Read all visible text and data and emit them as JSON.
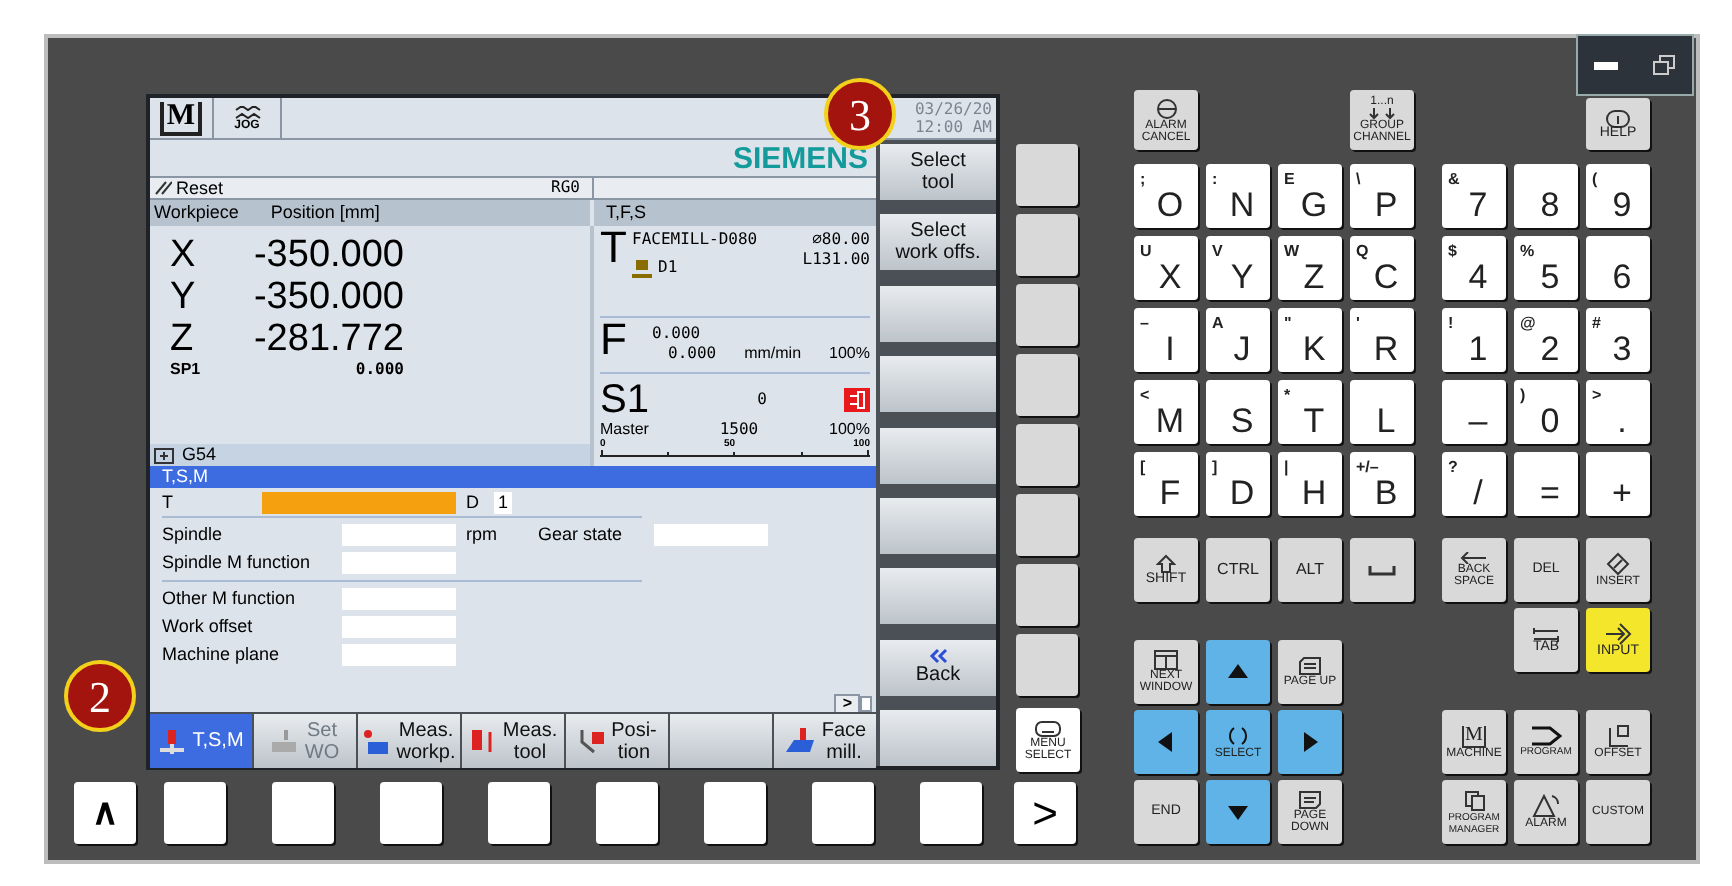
{
  "screen": {
    "header": {
      "mode_icon_text": "M",
      "jog_label": "JOG",
      "date": "03/26/20",
      "time": "12:00 AM"
    },
    "brand": "SIEMENS",
    "status": {
      "state": "Reset",
      "channel": "RG0"
    },
    "position_panel": {
      "headers": [
        "Workpiece",
        "Position [mm]"
      ],
      "axes": [
        {
          "kind": "axis",
          "name": "X",
          "value": "-350.000"
        },
        {
          "kind": "axis",
          "name": "Y",
          "value": "-350.000"
        },
        {
          "kind": "axis",
          "name": "Z",
          "value": "-281.772"
        },
        {
          "kind": "spindle",
          "name": "SP1",
          "value": "0.000"
        }
      ],
      "work_offset": "G54"
    },
    "tfs_panel": {
      "title": "T,F,S",
      "tool": {
        "letter": "T",
        "name": "FACEMILL-D080",
        "diameter": "⌀80.00",
        "edge": "D1",
        "length": "L131.00"
      },
      "feed": {
        "letter": "F",
        "setpoint": "0.000",
        "actual": "0.000",
        "unit": "mm/min",
        "override": "100%"
      },
      "spindle": {
        "letter": "S1",
        "speed": "0",
        "master": "Master",
        "setpoint": "1500",
        "override": "100%",
        "scale": [
          "0",
          "50",
          "100"
        ]
      }
    },
    "tsm_panel": {
      "title": "T,S,M",
      "tool_row": {
        "label": "T",
        "focused": true,
        "edge_label": "D",
        "edge_value": "1"
      },
      "groups": [
        [
          {
            "label": "Spindle",
            "focused": false,
            "unit": "rpm",
            "side_field": {
              "label": "Gear state",
              "focused": false
            }
          },
          {
            "label": "Spindle M function",
            "focused": false
          }
        ],
        [
          {
            "label": "Other M function",
            "focused": false
          },
          {
            "label": "Work offset",
            "focused": false
          },
          {
            "label": "Machine plane",
            "focused": false
          }
        ]
      ],
      "scroll_arrow": ">"
    },
    "horizontal_softkeys": [
      {
        "kind": "tool",
        "lines": [
          "T,S,M"
        ],
        "selected": true,
        "disabled": false
      },
      {
        "kind": "offset",
        "lines": [
          "Set",
          "WO"
        ],
        "selected": false,
        "disabled": true
      },
      {
        "kind": "workpiece",
        "lines": [
          "Meas.",
          "workp."
        ],
        "selected": false,
        "disabled": false
      },
      {
        "kind": "probe",
        "lines": [
          "Meas.",
          "tool"
        ],
        "selected": false,
        "disabled": false
      },
      {
        "kind": "position",
        "lines": [
          "Posi-",
          "tion"
        ],
        "selected": false,
        "disabled": false
      },
      {
        "kind": "blank"
      },
      {
        "kind": "facemill",
        "lines": [
          "Face",
          "mill."
        ],
        "selected": false,
        "disabled": false
      }
    ],
    "vertical_softkeys": [
      {
        "kind": "text",
        "lines": [
          "Select",
          "tool"
        ]
      },
      {
        "kind": "text",
        "lines": [
          "Select",
          "work offs."
        ]
      },
      {
        "kind": "blank"
      },
      {
        "kind": "blank"
      },
      {
        "kind": "blank"
      },
      {
        "kind": "blank"
      },
      {
        "kind": "blank"
      },
      {
        "kind": "back",
        "lines": [
          "Back"
        ]
      }
    ]
  },
  "side_keys": {
    "menu_select": "MENU SELECT"
  },
  "bottom_keys": {
    "left": "∧",
    "right": ">"
  },
  "keyboard": {
    "alarm_cancel": "ALARM CANCEL",
    "group_channel": {
      "icon_text": "1...n",
      "label": "GROUP CHANNEL"
    },
    "help": "HELP",
    "letters": [
      [
        {
          "main": "O",
          "alt": ";"
        },
        {
          "main": "N",
          "alt": ":"
        },
        {
          "main": "G",
          "alt": "E"
        },
        {
          "main": "P",
          "alt": "\\"
        }
      ],
      [
        {
          "main": "X",
          "alt": "U"
        },
        {
          "main": "Y",
          "alt": "V"
        },
        {
          "main": "Z",
          "alt": "W"
        },
        {
          "main": "C",
          "alt": "Q"
        }
      ],
      [
        {
          "main": "I",
          "alt": "–"
        },
        {
          "main": "J",
          "alt": "A"
        },
        {
          "main": "K",
          "alt": "\""
        },
        {
          "main": "R",
          "alt": "'"
        }
      ],
      [
        {
          "main": "M",
          "alt": "<"
        },
        {
          "main": "S"
        },
        {
          "main": "T",
          "alt": "*"
        },
        {
          "main": "L"
        }
      ],
      [
        {
          "main": "F",
          "alt": "["
        },
        {
          "main": "D",
          "alt": "]"
        },
        {
          "main": "H",
          "alt": "|"
        },
        {
          "main": "B",
          "alt": "+/–"
        }
      ]
    ],
    "shift": "SHIFT",
    "ctrl": "CTRL",
    "alt": "ALT",
    "numbers": [
      [
        {
          "main": "7",
          "alt": "&"
        },
        {
          "main": "8"
        },
        {
          "main": "9",
          "alt": "("
        }
      ],
      [
        {
          "main": "4",
          "alt": "$"
        },
        {
          "main": "5",
          "alt": "%"
        },
        {
          "main": "6"
        }
      ],
      [
        {
          "main": "1",
          "alt": "!"
        },
        {
          "main": "2",
          "alt": "@"
        },
        {
          "main": "3",
          "alt": "#"
        }
      ],
      [
        {
          "main": "–"
        },
        {
          "main": "0",
          "alt": ")"
        },
        {
          "main": ".",
          "alt": ">"
        }
      ],
      [
        {
          "main": "/",
          "alt": "?"
        },
        {
          "main": "="
        },
        {
          "main": "+"
        }
      ]
    ],
    "backspace": "BACK SPACE",
    "delete": "DEL",
    "insert": "INSERT",
    "tab": "TAB",
    "input": "INPUT",
    "next_window": "NEXT WINDOW",
    "page_up": "PAGE UP",
    "select": "SELECT",
    "page_down": "PAGE DOWN",
    "end": "END",
    "machine": {
      "icon_text": "M",
      "label": "MACHINE"
    },
    "program": "PROGRAM",
    "offset": "OFFSET",
    "program_manager": "PROGRAM MANAGER",
    "alarm": "ALARM",
    "custom": "CUSTOM"
  },
  "callouts": [
    {
      "number": "3"
    },
    {
      "number": "2"
    }
  ]
}
